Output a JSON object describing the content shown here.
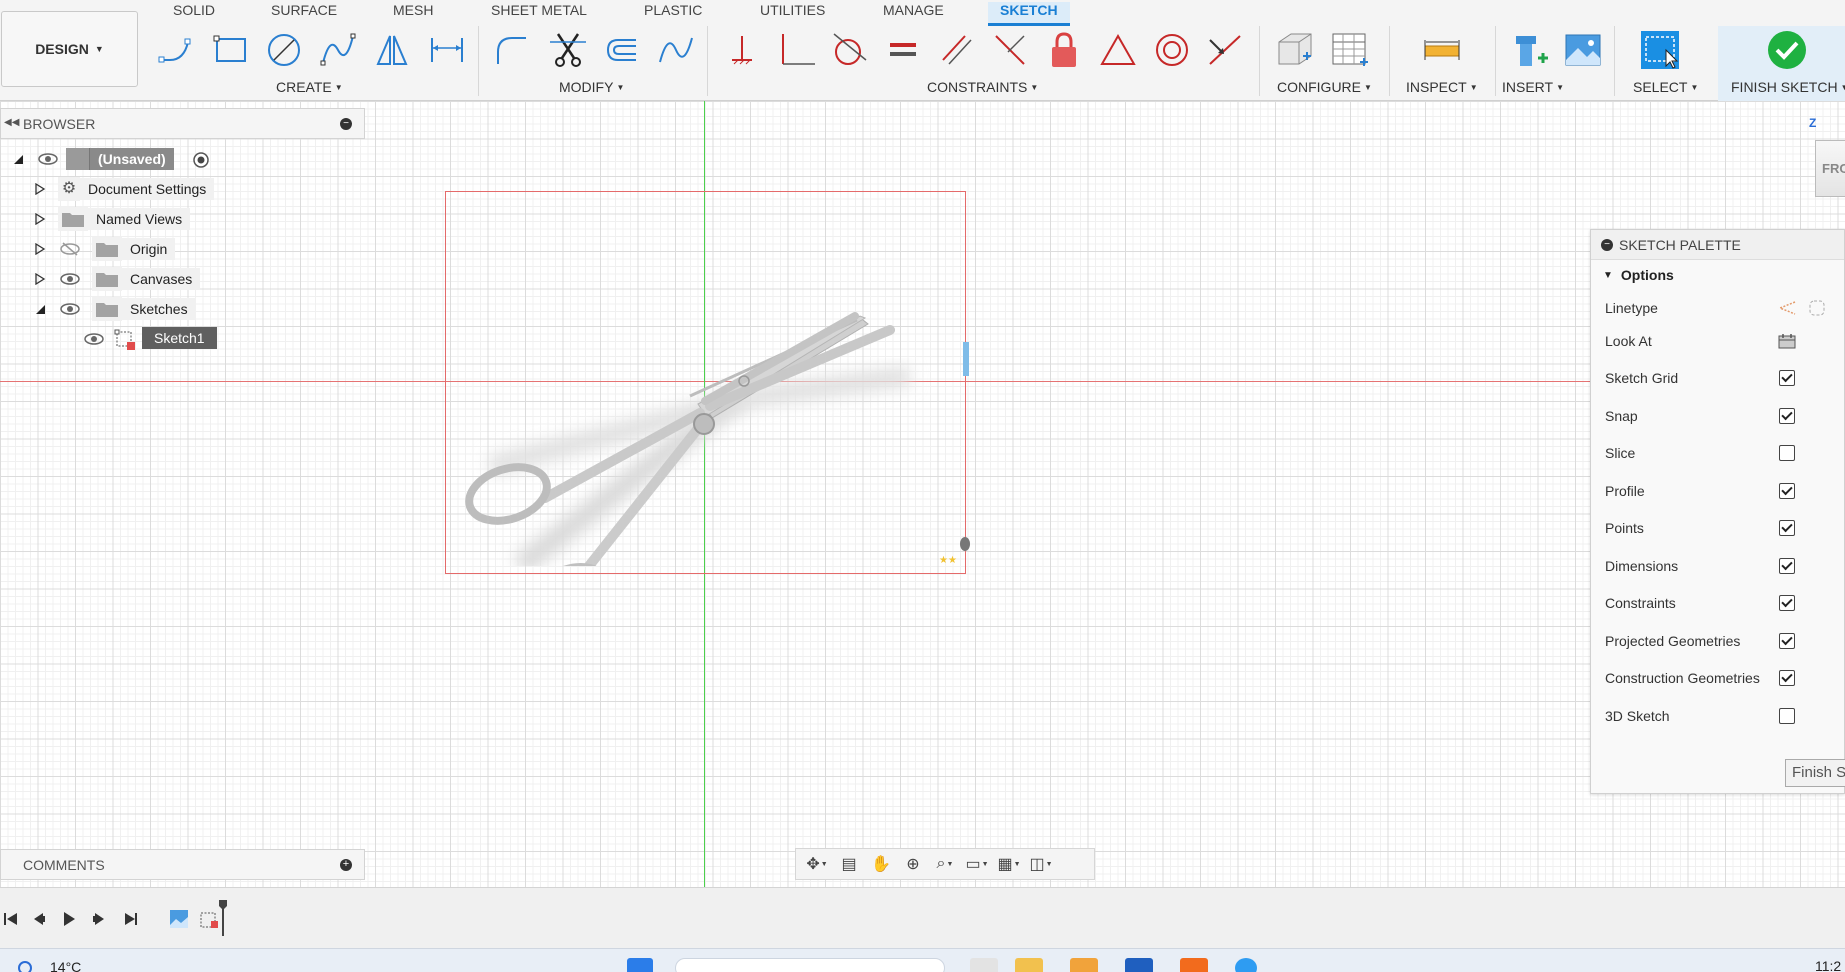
{
  "toolbar": {
    "design_label": "DESIGN",
    "tabs": [
      "SOLID",
      "SURFACE",
      "MESH",
      "SHEET METAL",
      "PLASTIC",
      "UTILITIES",
      "MANAGE",
      "SKETCH"
    ],
    "active_tab": "SKETCH",
    "groups": {
      "create": "CREATE",
      "modify": "MODIFY",
      "constraints": "CONSTRAINTS",
      "configure": "CONFIGURE",
      "inspect": "INSPECT",
      "insert": "INSERT",
      "select": "SELECT",
      "finish": "FINISH SKETCH"
    }
  },
  "browser": {
    "title": "BROWSER",
    "root": "(Unsaved)",
    "items": [
      {
        "label": "Document Settings",
        "icon": "gear-icon"
      },
      {
        "label": "Named Views",
        "icon": "folder-icon"
      },
      {
        "label": "Origin",
        "icon": "folder-icon"
      },
      {
        "label": "Canvases",
        "icon": "folder-icon"
      },
      {
        "label": "Sketches",
        "icon": "folder-icon"
      },
      {
        "label": "Sketch1",
        "icon": "sketch-icon"
      }
    ]
  },
  "palette": {
    "title": "SKETCH PALETTE",
    "section": "Options",
    "options": [
      {
        "label": "Linetype",
        "type": "icons"
      },
      {
        "label": "Look At",
        "type": "icon"
      },
      {
        "label": "Sketch Grid",
        "checked": true
      },
      {
        "label": "Snap",
        "checked": true
      },
      {
        "label": "Slice",
        "checked": false
      },
      {
        "label": "Profile",
        "checked": true
      },
      {
        "label": "Points",
        "checked": true
      },
      {
        "label": "Dimensions",
        "checked": true
      },
      {
        "label": "Constraints",
        "checked": true
      },
      {
        "label": "Projected Geometries",
        "checked": true
      },
      {
        "label": "Construction Geometries",
        "checked": true
      },
      {
        "label": "3D Sketch",
        "checked": false
      }
    ],
    "finish_button": "Finish S"
  },
  "viewcube": {
    "axis": "Z",
    "face": "FRO"
  },
  "comments": {
    "title": "COMMENTS"
  },
  "taskbar": {
    "weather": "14°C",
    "clock": "11:2"
  },
  "colors": {
    "accent": "#1a7fd4",
    "axis_x": "#e57373",
    "axis_y": "#4cd04c",
    "finish_green": "#1fb141"
  }
}
